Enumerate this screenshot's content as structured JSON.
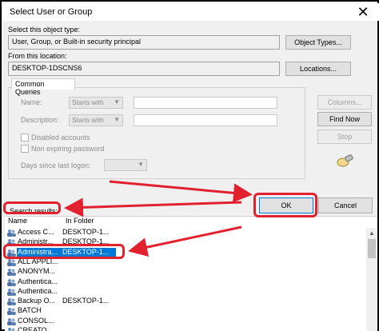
{
  "window": {
    "title": "Select User or Group",
    "close_glyph": "✕"
  },
  "object_type": {
    "label": "Select this object type:",
    "value": "User, Group, or Built-in security principal",
    "button": "Object Types..."
  },
  "location": {
    "label": "From this location:",
    "value": "DESKTOP-1DSCNS6",
    "button": "Locations..."
  },
  "common_queries": {
    "tab": "Common Queries",
    "name_label": "Name:",
    "name_mode": "Starts with",
    "description_label": "Description:",
    "description_mode": "Starts with",
    "disabled_accounts": "Disabled accounts",
    "non_expiring_password": "Non expiring password",
    "days_since_logon": "Days since last logon:",
    "columns_button": "Columns...",
    "find_now_button": "Find Now",
    "stop_button": "Stop"
  },
  "footer": {
    "ok_button": "OK",
    "cancel_button": "Cancel"
  },
  "results": {
    "label": "Search results:",
    "columns": [
      "Name",
      "In Folder"
    ],
    "rows": [
      {
        "name": "Access C...",
        "folder": "DESKTOP-1..."
      },
      {
        "name": "Administr...",
        "folder": "DESKTOP-1..."
      },
      {
        "name": "Administra...",
        "folder": "DESKTOP-1...",
        "selected": true
      },
      {
        "name": "ALL APPLI...",
        "folder": ""
      },
      {
        "name": "ANONYM...",
        "folder": ""
      },
      {
        "name": "Authentica...",
        "folder": ""
      },
      {
        "name": "Authentica...",
        "folder": ""
      },
      {
        "name": "Backup O...",
        "folder": "DESKTOP-1..."
      },
      {
        "name": "BATCH",
        "folder": ""
      },
      {
        "name": "CONSOL...",
        "folder": ""
      },
      {
        "name": "CREATO...",
        "folder": ""
      }
    ]
  },
  "colors": {
    "annotation_red": "#e2212e",
    "selection_blue": "#0078d7"
  }
}
